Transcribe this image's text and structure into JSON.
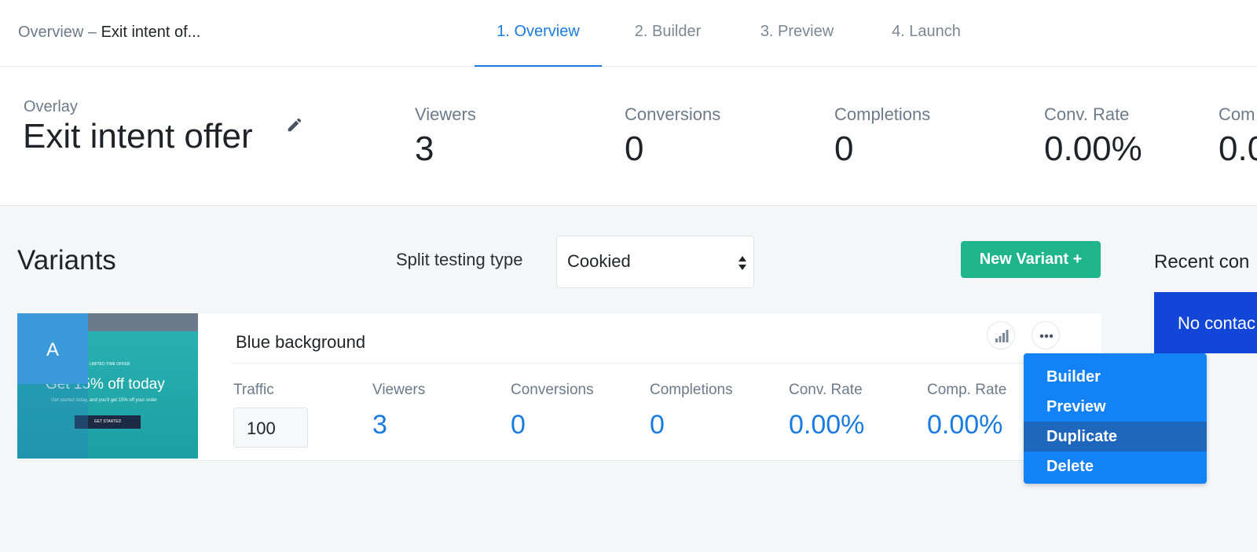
{
  "header": {
    "breadcrumb_prefix": "Overview –",
    "breadcrumb_title": "Exit intent of...",
    "tabs": [
      {
        "label": "1. Overview",
        "active": true
      },
      {
        "label": "2. Builder",
        "active": false
      },
      {
        "label": "3. Preview",
        "active": false
      },
      {
        "label": "4. Launch",
        "active": false
      }
    ]
  },
  "summary": {
    "type_label": "Overlay",
    "title": "Exit intent offer",
    "stats": [
      {
        "label": "Viewers",
        "value": "3"
      },
      {
        "label": "Conversions",
        "value": "0"
      },
      {
        "label": "Completions",
        "value": "0"
      },
      {
        "label": "Conv. Rate",
        "value": "0.00%"
      },
      {
        "label": "Com",
        "value": "0.0"
      }
    ]
  },
  "variants": {
    "title": "Variants",
    "split_label": "Split testing type",
    "split_value": "Cookied",
    "new_variant_label": "New Variant +",
    "items": [
      {
        "badge": "A",
        "name": "Blue background",
        "thumb": {
          "offer": "LIMITED TIME OFFER",
          "headline": "Get 15% off today",
          "sub": "Get started today, and you'll get 15% off your order",
          "button": "GET STARTED"
        },
        "traffic_label": "Traffic",
        "traffic_value": "100",
        "metrics": [
          {
            "label": "Viewers",
            "value": "3"
          },
          {
            "label": "Conversions",
            "value": "0"
          },
          {
            "label": "Completions",
            "value": "0"
          },
          {
            "label": "Conv. Rate",
            "value": "0.00%"
          },
          {
            "label": "Comp. Rate",
            "value": "0.00%"
          }
        ]
      }
    ]
  },
  "menu": {
    "items": [
      {
        "label": "Builder",
        "highlighted": false
      },
      {
        "label": "Preview",
        "highlighted": false
      },
      {
        "label": "Duplicate",
        "highlighted": true
      },
      {
        "label": "Delete",
        "highlighted": false
      }
    ]
  },
  "sidebar": {
    "recent_title": "Recent con",
    "no_contacts": "No contac"
  },
  "icons": {
    "edit": "pencil-icon",
    "stats": "bar-chart-icon",
    "more": "ellipsis-icon",
    "select": "updown-arrows-icon"
  },
  "colors": {
    "accent": "#1a7be0",
    "primary_button": "#1fb58a",
    "menu": "#1482f7",
    "menu_highlight": "#1f67bd",
    "contacts_panel": "#1146d8"
  }
}
